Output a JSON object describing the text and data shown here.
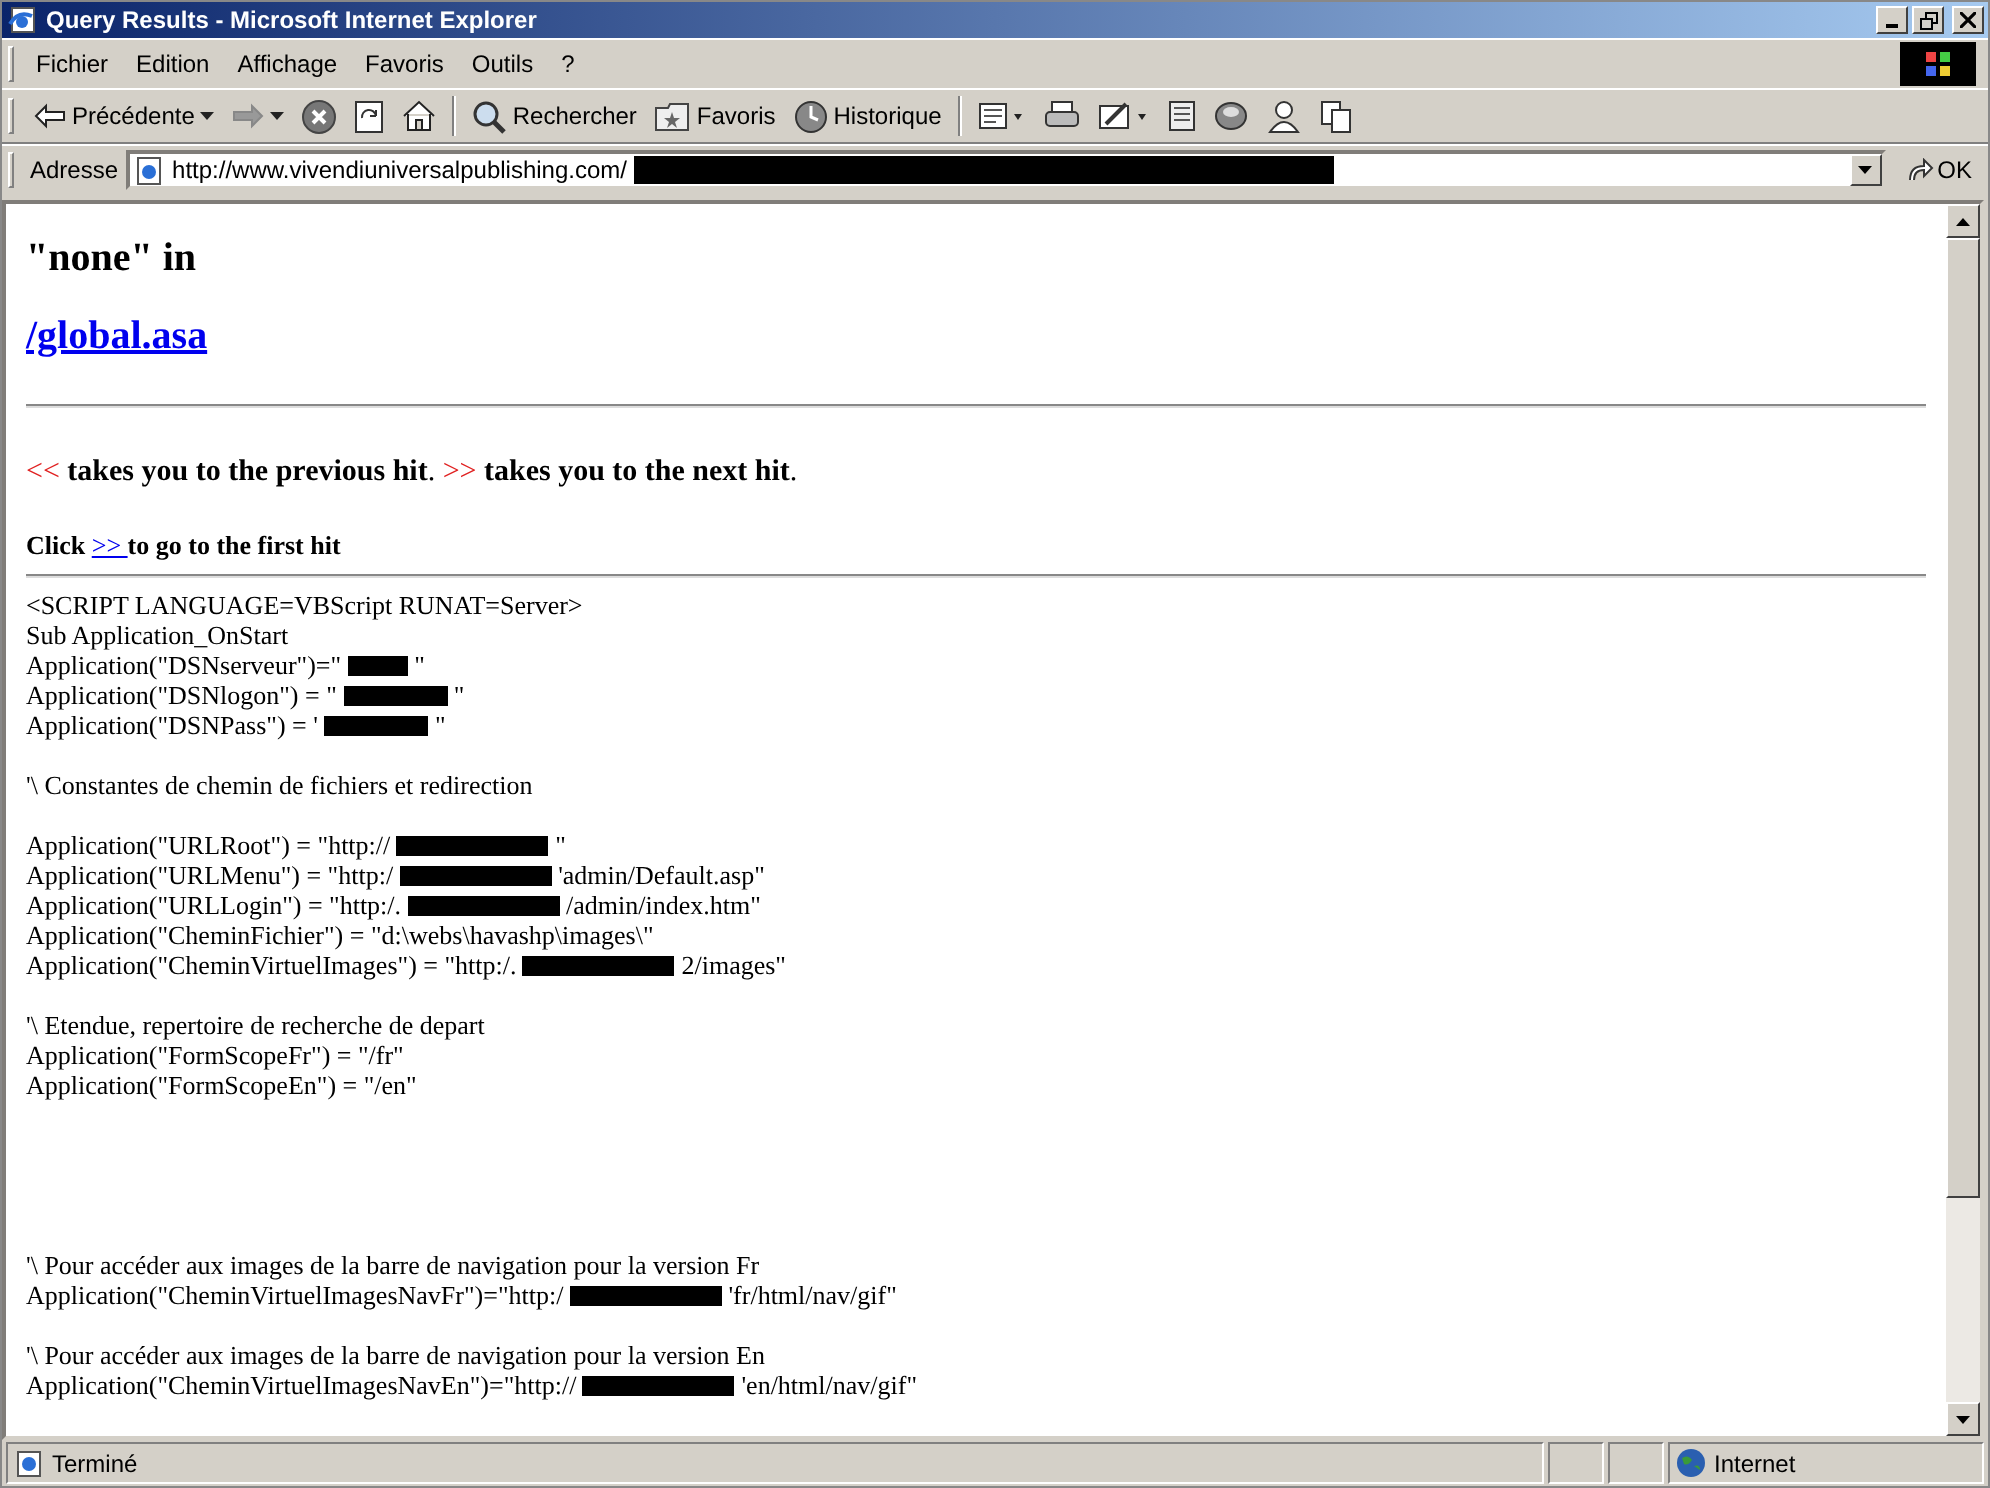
{
  "window": {
    "title": "Query Results - Microsoft Internet Explorer"
  },
  "menu": [
    {
      "label": "Fichier"
    },
    {
      "label": "Edition"
    },
    {
      "label": "Affichage"
    },
    {
      "label": "Favoris"
    },
    {
      "label": "Outils"
    },
    {
      "label": "?"
    }
  ],
  "toolbar": [
    {
      "kind": "back",
      "label": "Précédente"
    },
    {
      "kind": "forward"
    },
    {
      "kind": "stop"
    },
    {
      "kind": "refresh"
    },
    {
      "kind": "home"
    },
    {
      "kind": "separator"
    },
    {
      "kind": "search",
      "label": "Rechercher"
    },
    {
      "kind": "favorites",
      "label": "Favoris"
    },
    {
      "kind": "history",
      "label": "Historique"
    },
    {
      "kind": "separator"
    },
    {
      "kind": "mail"
    },
    {
      "kind": "print"
    },
    {
      "kind": "edit"
    },
    {
      "kind": "discuss"
    },
    {
      "kind": "messenger"
    },
    {
      "kind": "people"
    },
    {
      "kind": "copy"
    }
  ],
  "address": {
    "label": "Adresse",
    "value": "http://www.vivendiuniversalpublishing.com/",
    "go": "OK"
  },
  "page": {
    "heading": "\"none\" in",
    "file_link": "/global.asa",
    "nav_help": [
      {
        "kind": "mark",
        "text": "<<"
      },
      {
        "kind": "text",
        "text": " takes you to the previous hit"
      },
      {
        "kind": "plain",
        "text": ". "
      },
      {
        "kind": "mark",
        "text": ">>"
      },
      {
        "kind": "text",
        "text": " takes you to the next hit"
      },
      {
        "kind": "plain",
        "text": "."
      }
    ],
    "first_hit": {
      "before": "Click ",
      "link": ">> ",
      "after": "to go to the first hit"
    },
    "code": [
      {
        "kind": "code",
        "parts": [
          {
            "kind": "text",
            "text": "<SCRIPT LANGUAGE=VBScript RUNAT=Server>"
          }
        ]
      },
      {
        "kind": "code",
        "parts": [
          {
            "kind": "text",
            "text": "Sub Application_OnStart"
          }
        ]
      },
      {
        "kind": "code",
        "parts": [
          {
            "kind": "text",
            "text": "Application(\"DSNserveur\")=\" "
          },
          {
            "kind": "redact-s"
          },
          {
            "kind": "text",
            "text": " \""
          }
        ]
      },
      {
        "kind": "code",
        "parts": [
          {
            "kind": "text",
            "text": "Application(\"DSNlogon\") = \" "
          },
          {
            "kind": "redact-m"
          },
          {
            "kind": "text",
            "text": " \""
          }
        ]
      },
      {
        "kind": "code",
        "parts": [
          {
            "kind": "text",
            "text": "Application(\"DSNPass\") = ' "
          },
          {
            "kind": "redact-m"
          },
          {
            "kind": "text",
            "text": " \""
          }
        ]
      },
      {
        "kind": "blank"
      },
      {
        "kind": "code",
        "parts": [
          {
            "kind": "text",
            "text": "'\\ Constantes de chemin de fichiers et redirection"
          }
        ]
      },
      {
        "kind": "blank"
      },
      {
        "kind": "code",
        "parts": [
          {
            "kind": "text",
            "text": "Application(\"URLRoot\") = \"http:// "
          },
          {
            "kind": "redact-l"
          },
          {
            "kind": "text",
            "text": " \""
          }
        ]
      },
      {
        "kind": "code",
        "parts": [
          {
            "kind": "text",
            "text": "Application(\"URLMenu\") = \"http:/ "
          },
          {
            "kind": "redact-l"
          },
          {
            "kind": "text",
            "text": " 'admin/Default.asp\""
          }
        ]
      },
      {
        "kind": "code",
        "parts": [
          {
            "kind": "text",
            "text": "Application(\"URLLogin\") = \"http:/. "
          },
          {
            "kind": "redact-l"
          },
          {
            "kind": "text",
            "text": " /admin/index.htm\""
          }
        ]
      },
      {
        "kind": "code",
        "parts": [
          {
            "kind": "text",
            "text": "Application(\"CheminFichier\") = \"d:\\webs\\havashp\\images\\\""
          }
        ]
      },
      {
        "kind": "code",
        "parts": [
          {
            "kind": "text",
            "text": "Application(\"CheminVirtuelImages\") = \"http:/. "
          },
          {
            "kind": "redact-l"
          },
          {
            "kind": "text",
            "text": " 2/images\""
          }
        ]
      },
      {
        "kind": "blank"
      },
      {
        "kind": "code",
        "parts": [
          {
            "kind": "text",
            "text": "'\\ Etendue, repertoire de recherche de depart"
          }
        ]
      },
      {
        "kind": "code",
        "parts": [
          {
            "kind": "text",
            "text": "Application(\"FormScopeFr\") = \"/fr\""
          }
        ]
      },
      {
        "kind": "code",
        "parts": [
          {
            "kind": "text",
            "text": "Application(\"FormScopeEn\") = \"/en\""
          }
        ]
      },
      {
        "kind": "blank"
      },
      {
        "kind": "blank"
      },
      {
        "kind": "blank"
      },
      {
        "kind": "blank"
      },
      {
        "kind": "blank"
      },
      {
        "kind": "code",
        "parts": [
          {
            "kind": "text",
            "text": "'\\ Pour accéder aux images de la barre de navigation pour la version Fr"
          }
        ]
      },
      {
        "kind": "code",
        "parts": [
          {
            "kind": "text",
            "text": "Application(\"CheminVirtuelImagesNavFr\")=\"http:/ "
          },
          {
            "kind": "redact-l"
          },
          {
            "kind": "text",
            "text": " 'fr/html/nav/gif\""
          }
        ]
      },
      {
        "kind": "blank"
      },
      {
        "kind": "code",
        "parts": [
          {
            "kind": "text",
            "text": "'\\ Pour accéder aux images de la barre de navigation pour la version En"
          }
        ]
      },
      {
        "kind": "code",
        "parts": [
          {
            "kind": "text",
            "text": "Application(\"CheminVirtuelImagesNavEn\")=\"http:// "
          },
          {
            "kind": "redact-l"
          },
          {
            "kind": "text",
            "text": " 'en/html/nav/gif\""
          }
        ]
      }
    ]
  },
  "status_bar": {
    "text": "Terminé",
    "zone": "Internet"
  }
}
